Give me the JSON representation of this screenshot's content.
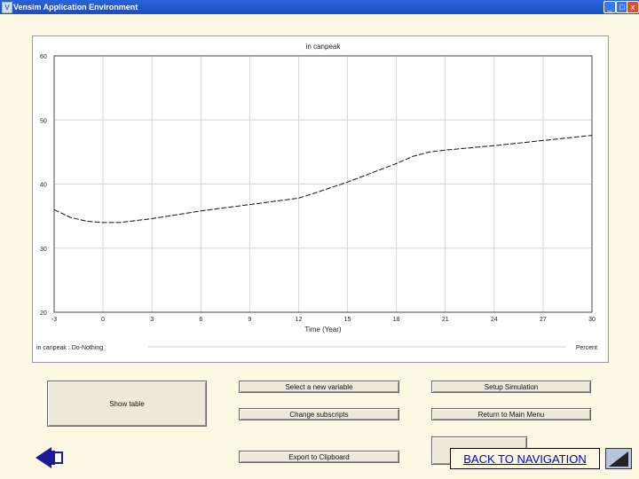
{
  "window": {
    "title": "Vensim Application Environment",
    "buttons": [
      "_",
      "□",
      "x"
    ]
  },
  "chart_data": {
    "type": "line",
    "title": "in canpeak",
    "xlabel": "Time (Year)",
    "ylabel": "",
    "xlim": [
      -3,
      30
    ],
    "ylim": [
      20,
      60
    ],
    "x_ticks": [
      "-3",
      "0",
      "3",
      "6",
      "9",
      "12",
      "15",
      "18",
      "21",
      "24",
      "27",
      "30"
    ],
    "y_ticks": [
      "60",
      "50",
      "40",
      "30",
      "20"
    ],
    "grid": true,
    "legend_left": "in canpeak : Do-Nothing",
    "legend_right": "Percent",
    "series": [
      {
        "name": "in canpeak : Do-Nothing",
        "x": [
          -3,
          -2,
          -1,
          0,
          1,
          3,
          6,
          9,
          12,
          13,
          15,
          18,
          19,
          20,
          21,
          24,
          27,
          30
        ],
        "y": [
          36.0,
          34.8,
          34.2,
          34.0,
          34.0,
          34.6,
          35.8,
          36.8,
          37.8,
          38.6,
          40.3,
          43.2,
          44.3,
          45.0,
          45.3,
          46.0,
          46.8,
          47.6
        ]
      }
    ]
  },
  "buttons": {
    "show_table": "Show table",
    "select_variable": "Select a new variable",
    "setup_simulation": "Setup Simulation",
    "change_subscripts": "Change subscripts",
    "return_main_menu": "Return to Main Menu",
    "export_clipboard": "Export to Clipboard"
  },
  "navigation": {
    "back_label": "BACK TO NAVIGATION"
  }
}
